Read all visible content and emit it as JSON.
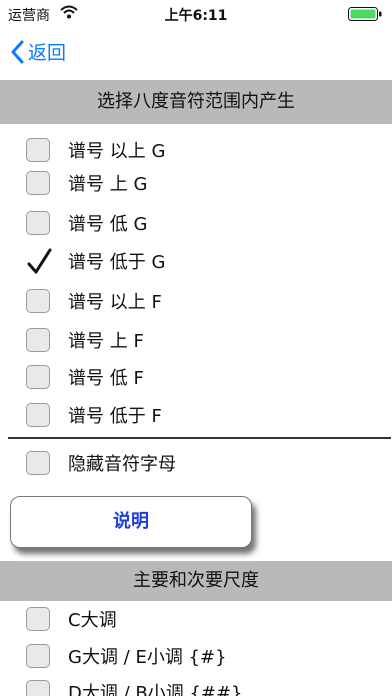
{
  "status_bar": {
    "carrier": "运营商",
    "time": "上午6:11",
    "battery_color": "#4cd964"
  },
  "nav": {
    "back_label": "返回",
    "accent_color": "#0a7aff"
  },
  "octave_section": {
    "title": "选择八度音符范围内产生",
    "options": [
      {
        "label": "谱号 以上 G",
        "checked": false
      },
      {
        "label": "谱号 上 G",
        "checked": false
      },
      {
        "label": "谱号 低 G",
        "checked": false
      },
      {
        "label": "谱号 低于 G",
        "checked": true
      },
      {
        "label": "谱号 以上 F",
        "checked": false
      },
      {
        "label": "谱号 上 F",
        "checked": false
      },
      {
        "label": "谱号 低 F",
        "checked": false
      },
      {
        "label": "谱号 低于 F",
        "checked": false
      }
    ]
  },
  "hide_letters": {
    "label": "隐藏音符字母",
    "checked": false
  },
  "explain_button": {
    "label": "说明"
  },
  "scale_section": {
    "title": "主要和次要尺度",
    "options": [
      {
        "label": "C大调",
        "checked": false
      },
      {
        "label": "G大调 / E小调 {#}",
        "checked": false
      },
      {
        "label": "D大调 / B小调 {##}",
        "checked": false
      }
    ]
  }
}
